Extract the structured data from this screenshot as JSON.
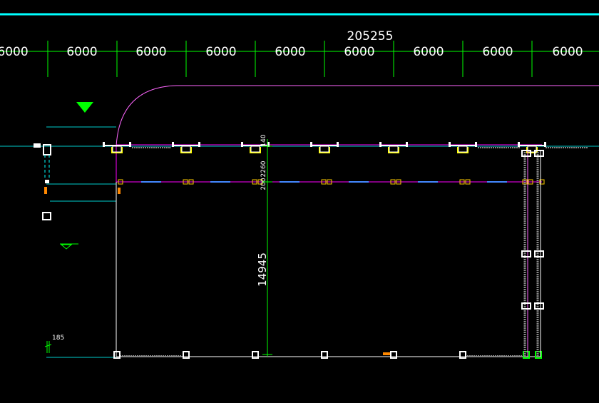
{
  "drawing": {
    "overall_dimension": "205255",
    "span_labels": [
      "6000",
      "6000",
      "6000",
      "6000",
      "6000",
      "6000",
      "6000",
      "6000",
      "6000"
    ],
    "vertical_main_dimension": "14945",
    "small_dims": {
      "top_gap": "140",
      "second_gap": "2260",
      "third_gap": "200",
      "left_small": "185"
    }
  },
  "colors": {
    "background": "#000000",
    "dimension": "#00ff00",
    "axis_line": "#00ffff",
    "boundary": "#ff00ff",
    "outline": "#ffffff",
    "highlight": "#ffff00",
    "marker": "#ff8800"
  }
}
